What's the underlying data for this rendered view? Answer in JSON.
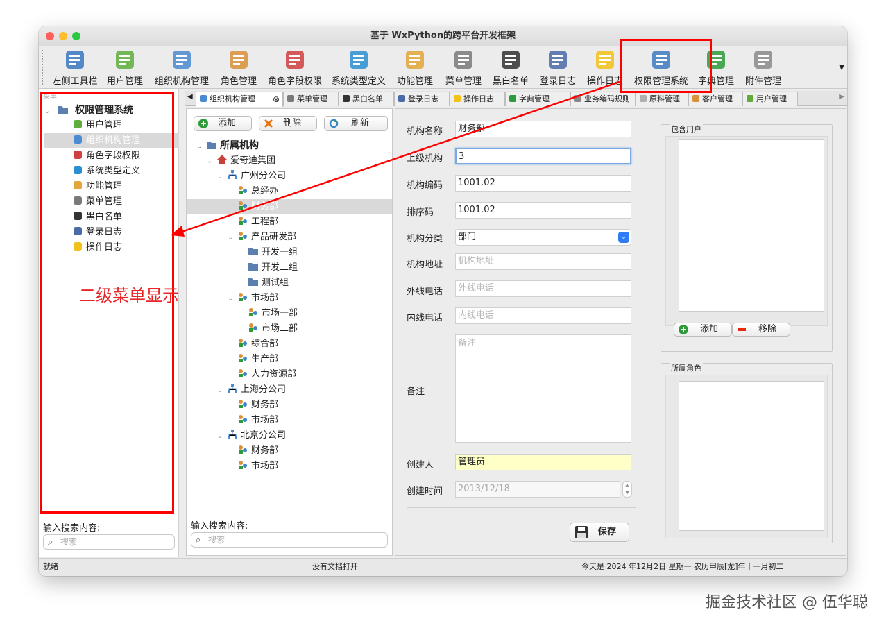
{
  "window": {
    "title": "基于 WxPython的跨平台开发框架"
  },
  "toolbar": {
    "items": [
      {
        "label": "左侧工具栏",
        "icon": "panel-icon"
      },
      {
        "label": "用户管理",
        "icon": "user-icon"
      },
      {
        "label": "组织机构管理",
        "icon": "org-chart-icon"
      },
      {
        "label": "角色管理",
        "icon": "role-icon"
      },
      {
        "label": "角色字段权限",
        "icon": "traffic-light-icon"
      },
      {
        "label": "系统类型定义",
        "icon": "monitor-icon"
      },
      {
        "label": "功能管理",
        "icon": "keys-icon"
      },
      {
        "label": "菜单管理",
        "icon": "menu-doc-icon"
      },
      {
        "label": "黑白名单",
        "icon": "spy-icon"
      },
      {
        "label": "登录日志",
        "icon": "log-icon"
      },
      {
        "label": "操作日志",
        "icon": "warning-icon"
      },
      {
        "label": "权限管理系统",
        "icon": "network-icon"
      },
      {
        "label": "字典管理",
        "icon": "dictionary-icon"
      },
      {
        "label": "附件管理",
        "icon": "paperclip-icon"
      }
    ]
  },
  "left_tree": {
    "hint": "菜单",
    "root": "权限管理系统",
    "items": [
      "用户管理",
      "组织机构管理",
      "角色字段权限",
      "系统类型定义",
      "功能管理",
      "菜单管理",
      "黑白名单",
      "登录日志",
      "操作日志"
    ],
    "selected_index": 1,
    "search_label": "输入搜索内容:",
    "search_placeholder": "搜索"
  },
  "tabs": [
    {
      "label": "组织机构管理",
      "active": true
    },
    {
      "label": "菜单管理"
    },
    {
      "label": "黑白名单"
    },
    {
      "label": "登录日志"
    },
    {
      "label": "操作日志"
    },
    {
      "label": "字典管理"
    },
    {
      "label": "业务编码规则"
    },
    {
      "label": "原料管理"
    },
    {
      "label": "客户管理"
    },
    {
      "label": "用户管理"
    }
  ],
  "org": {
    "buttons": {
      "add": "添加",
      "delete": "删除",
      "refresh": "刷新"
    },
    "tree": [
      {
        "label": "所属机构",
        "level": 0,
        "kind": "folder",
        "bold": true
      },
      {
        "label": "爱奇迪集团",
        "level": 1,
        "kind": "home"
      },
      {
        "label": "广州分公司",
        "level": 2,
        "kind": "branch"
      },
      {
        "label": "总经办",
        "level": 3,
        "kind": "dept"
      },
      {
        "label": "财务部",
        "level": 3,
        "kind": "dept",
        "selected": true
      },
      {
        "label": "工程部",
        "level": 3,
        "kind": "dept"
      },
      {
        "label": "产品研发部",
        "level": 3,
        "kind": "dept",
        "expanded": true
      },
      {
        "label": "开发一组",
        "level": 4,
        "kind": "folder"
      },
      {
        "label": "开发二组",
        "level": 4,
        "kind": "folder"
      },
      {
        "label": "测试组",
        "level": 4,
        "kind": "folder"
      },
      {
        "label": "市场部",
        "level": 3,
        "kind": "dept",
        "expanded": true
      },
      {
        "label": "市场一部",
        "level": 4,
        "kind": "dept"
      },
      {
        "label": "市场二部",
        "level": 4,
        "kind": "dept"
      },
      {
        "label": "综合部",
        "level": 3,
        "kind": "dept"
      },
      {
        "label": "生产部",
        "level": 3,
        "kind": "dept"
      },
      {
        "label": "人力资源部",
        "level": 3,
        "kind": "dept"
      },
      {
        "label": "上海分公司",
        "level": 2,
        "kind": "branch"
      },
      {
        "label": "财务部",
        "level": 3,
        "kind": "dept"
      },
      {
        "label": "市场部",
        "level": 3,
        "kind": "dept"
      },
      {
        "label": "北京分公司",
        "level": 2,
        "kind": "branch"
      },
      {
        "label": "财务部",
        "level": 3,
        "kind": "dept"
      },
      {
        "label": "市场部",
        "level": 3,
        "kind": "dept"
      }
    ],
    "search_label": "输入搜索内容:",
    "search_placeholder": "搜索"
  },
  "form": {
    "name_label": "机构名称",
    "name_value": "财务部",
    "parent_label": "上级机构",
    "parent_value": "3",
    "code_label": "机构编码",
    "code_value": "1001.02",
    "sort_label": "排序码",
    "sort_value": "1001.02",
    "category_label": "机构分类",
    "category_value": "部门",
    "address_label": "机构地址",
    "address_placeholder": "机构地址",
    "outer_phone_label": "外线电话",
    "outer_phone_placeholder": "外线电话",
    "inner_phone_label": "内线电话",
    "inner_phone_placeholder": "内线电话",
    "note_label": "备注",
    "note_placeholder": "备注",
    "creator_label": "创建人",
    "creator_value": "管理员",
    "created_label": "创建时间",
    "created_value": "2013/12/18",
    "save_label": "保存"
  },
  "users_group": {
    "title": "包含用户",
    "add_label": "添加",
    "remove_label": "移除"
  },
  "roles_group": {
    "title": "所属角色"
  },
  "status": {
    "left": "就绪",
    "middle": "没有文档打开",
    "right": "今天是 2024 年12月2日 星期一 农历甲辰[龙]年十一月初二"
  },
  "annotation": {
    "text": "二级菜单显示"
  },
  "watermark": {
    "text": "掘金技术社区 @ 伍华聪"
  },
  "colors": {
    "annotation_red": "#f00000",
    "highlight_blue": "#3b82f6",
    "creator_bg": "#ffffc8"
  }
}
